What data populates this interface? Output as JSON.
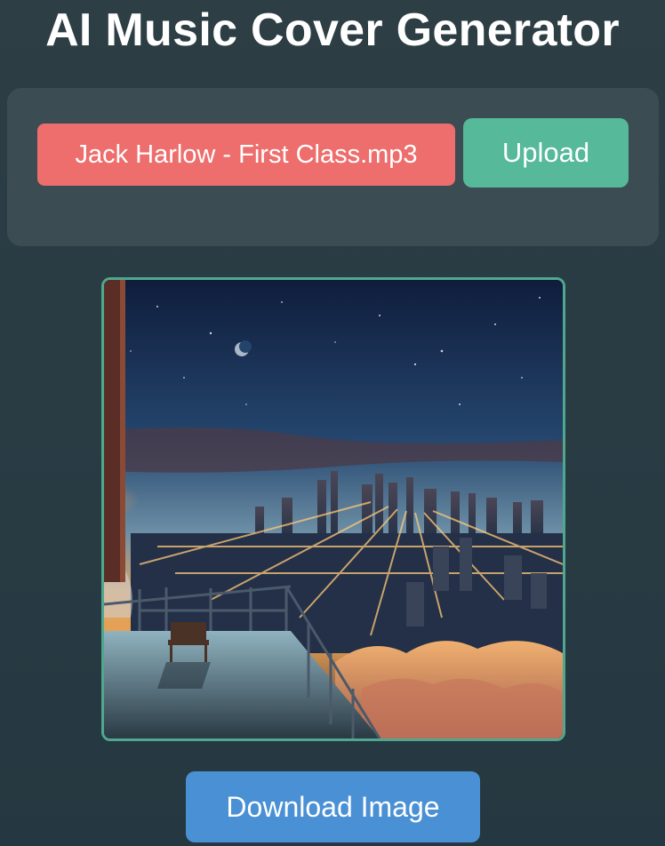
{
  "app": {
    "title": "AI Music Cover Generator"
  },
  "upload_panel": {
    "file_name": "Jack Harlow - First Class.mp3",
    "upload_label": "Upload"
  },
  "cover": {
    "alt": "Generated album cover: city skyline at sunset seen from a rooftop balcony above the clouds"
  },
  "actions": {
    "download_label": "Download Image"
  },
  "colors": {
    "file_pill": "#ed6e6c",
    "upload_button": "#55b99a",
    "download_button": "#4a90d4",
    "frame_border": "#4fa88e"
  }
}
